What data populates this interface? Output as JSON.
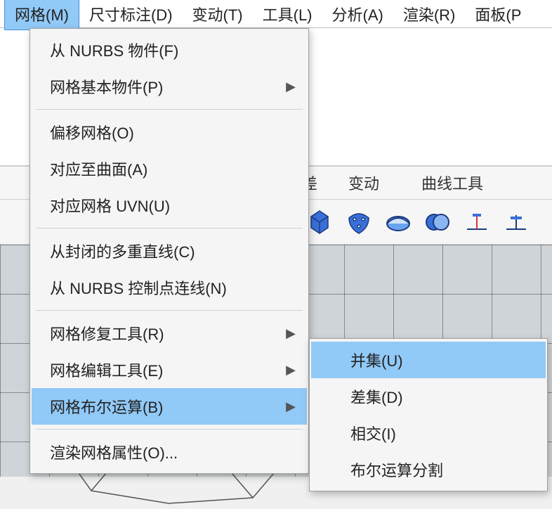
{
  "menubar": {
    "items": [
      {
        "label": "网格(M)",
        "active": true
      },
      {
        "label": "尺寸标注(D)",
        "active": false
      },
      {
        "label": "变动(T)",
        "active": false
      },
      {
        "label": "工具(L)",
        "active": false
      },
      {
        "label": "分析(A)",
        "active": false
      },
      {
        "label": "渲染(R)",
        "active": false
      },
      {
        "label": "面板(P",
        "active": false
      }
    ]
  },
  "tabs": {
    "items": [
      {
        "label": "变动"
      },
      {
        "label": "曲线工具"
      }
    ],
    "partial_left_char": "差"
  },
  "dropdown": {
    "groups": [
      [
        {
          "label": "从 NURBS 物件(F)",
          "submenu": false
        },
        {
          "label": "网格基本物件(P)",
          "submenu": true
        }
      ],
      [
        {
          "label": "偏移网格(O)",
          "submenu": false
        },
        {
          "label": "对应至曲面(A)",
          "submenu": false
        },
        {
          "label": "对应网格 UVN(U)",
          "submenu": false
        }
      ],
      [
        {
          "label": "从封闭的多重直线(C)",
          "submenu": false
        },
        {
          "label": "从 NURBS 控制点连线(N)",
          "submenu": false
        }
      ],
      [
        {
          "label": "网格修复工具(R)",
          "submenu": true
        },
        {
          "label": "网格编辑工具(E)",
          "submenu": true
        },
        {
          "label": "网格布尔运算(B)",
          "submenu": true,
          "hovered": true
        }
      ],
      [
        {
          "label": "渲染网格属性(O)...",
          "submenu": false
        }
      ]
    ]
  },
  "submenu": {
    "items": [
      {
        "label": "并集(U)",
        "hovered": true
      },
      {
        "label": "差集(D)",
        "hovered": false
      },
      {
        "label": "相交(I)",
        "hovered": false
      },
      {
        "label": "布尔运算分割",
        "hovered": false
      }
    ]
  },
  "toolbar_icons": [
    "mesh-diamond-icon",
    "mesh-deform-icon",
    "shell-icon",
    "boolean-icon",
    "tool-a-icon",
    "tool-b-icon"
  ]
}
